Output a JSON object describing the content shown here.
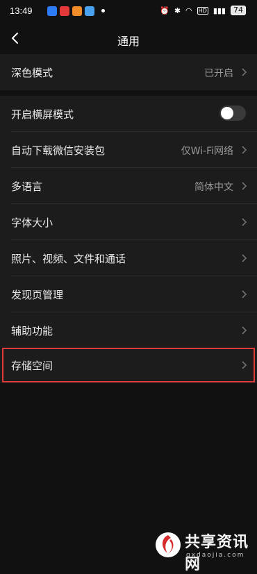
{
  "status_bar": {
    "time": "13:49",
    "apps": [
      "app-icon-blue",
      "app-icon-red",
      "app-icon-orange",
      "app-icon-lightblue"
    ],
    "battery": "74",
    "icons": [
      "alarm-icon",
      "bluetooth-icon",
      "wifi-icon",
      "hd-icon",
      "signal-icon",
      "battery-icon"
    ]
  },
  "header": {
    "title": "通用"
  },
  "rows": [
    {
      "label": "深色模式",
      "value": "已开启"
    },
    {
      "label": "开启横屏模式",
      "toggle": false
    },
    {
      "label": "自动下载微信安装包",
      "value": "仅Wi-Fi网络"
    },
    {
      "label": "多语言",
      "value": "简体中文"
    },
    {
      "label": "字体大小",
      "value": ""
    },
    {
      "label": "照片、视频、文件和通话",
      "value": ""
    },
    {
      "label": "发现页管理",
      "value": ""
    },
    {
      "label": "辅助功能",
      "value": ""
    },
    {
      "label": "存储空间",
      "value": ""
    }
  ],
  "colors": {
    "background": "#111111",
    "row": "#1c1c1c",
    "highlight": "#e03a3a"
  },
  "watermark": {
    "text": "共享资讯网",
    "sub": "gxdaojia.com"
  }
}
